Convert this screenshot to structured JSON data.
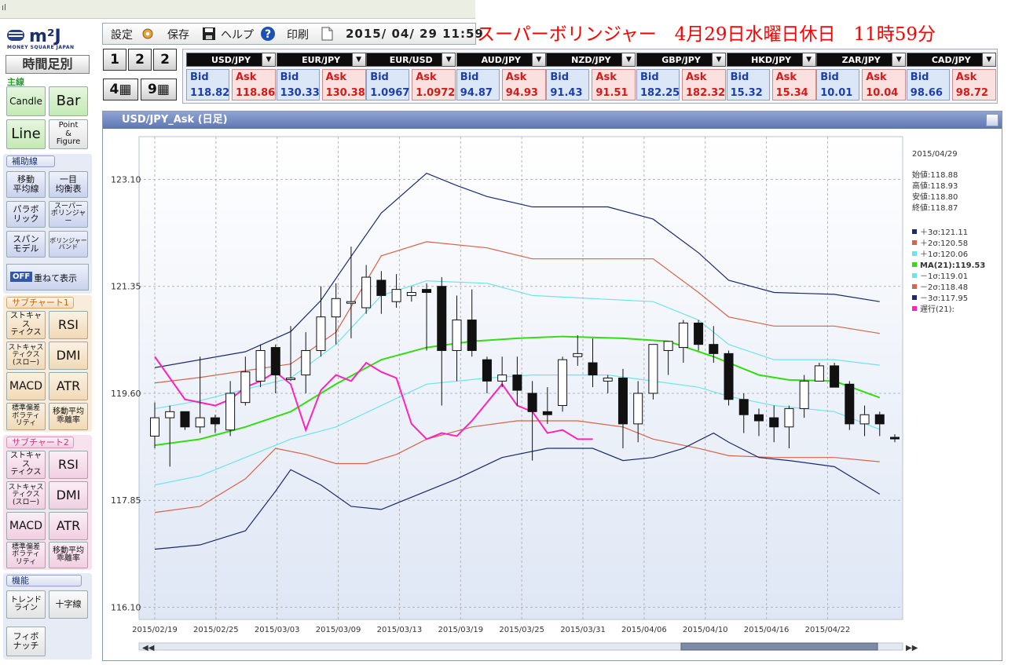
{
  "window": {
    "strip_text": "ıl"
  },
  "banner": {
    "text": "スーパーボリンジャー　4月29日水曜日休日　11時59分"
  },
  "sidebar": {
    "logo_mark": "m²J",
    "logo_sub": "MONEY SQUARE JAPAN",
    "timeframe_label": "時間足別",
    "main_label": "主線",
    "main_buttons": [
      {
        "label": "Candle"
      },
      {
        "label": "Bar"
      },
      {
        "label": "Line"
      },
      {
        "label": "Point\n&\nFigure"
      }
    ],
    "aux_title": "補助線",
    "aux_buttons": [
      {
        "label": "移動\n平均線"
      },
      {
        "label": "一目\n均衡表"
      },
      {
        "label": "パラボ\nリック"
      },
      {
        "label": "スーパー\nボリンジャー"
      },
      {
        "label": "スパン\nモデル"
      },
      {
        "label": "ボリンジャー\nバンド"
      }
    ],
    "overlay_toggle": {
      "state": "OFF",
      "label": "重ねて表示"
    },
    "sub1_title": "サブチャート1",
    "sub1_buttons": [
      {
        "label": "ストキャス\nティクス"
      },
      {
        "label": "RSI"
      },
      {
        "label": "ストキャス\nティクス\n(スロー)"
      },
      {
        "label": "DMI"
      },
      {
        "label": "MACD"
      },
      {
        "label": "ATR"
      },
      {
        "label": "標準偏差\nボラティ\nリティ"
      },
      {
        "label": "移動平均\n乖離率"
      }
    ],
    "sub2_title": "サブチャート2",
    "sub2_buttons": [
      {
        "label": "ストキャス\nティクス"
      },
      {
        "label": "RSI"
      },
      {
        "label": "ストキャス\nティクス\n(スロー)"
      },
      {
        "label": "DMI"
      },
      {
        "label": "MACD"
      },
      {
        "label": "ATR"
      },
      {
        "label": "標準偏差\nボラティ\nリティ"
      },
      {
        "label": "移動平均\n乖離率"
      }
    ],
    "func_title": "機能",
    "func_buttons": [
      {
        "label": "トレンド\nライン"
      },
      {
        "label": "十字線"
      },
      {
        "label": "フィボ\nナッチ"
      }
    ]
  },
  "toolbar": {
    "settings_label": "設定",
    "save_label": "保存",
    "help_label": "ヘルプ",
    "print_label": "印刷",
    "datetime": "2015/ 04/ 29  11:59"
  },
  "layout_buttons": [
    "1",
    "2",
    "2",
    "4",
    "9"
  ],
  "rates": [
    {
      "pair": "USD/JPY",
      "bid": "118.82",
      "ask": "118.86"
    },
    {
      "pair": "EUR/JPY",
      "bid": "130.33",
      "ask": "130.38"
    },
    {
      "pair": "EUR/USD",
      "bid": "1.0967",
      "ask": "1.0972"
    },
    {
      "pair": "AUD/JPY",
      "bid": "94.87",
      "ask": "94.93"
    },
    {
      "pair": "NZD/JPY",
      "bid": "91.43",
      "ask": "91.51"
    },
    {
      "pair": "GBP/JPY",
      "bid": "182.25",
      "ask": "182.32"
    },
    {
      "pair": "HKD/JPY",
      "bid": "15.32",
      "ask": "15.34"
    },
    {
      "pair": "ZAR/JPY",
      "bid": "10.01",
      "ask": "10.04"
    },
    {
      "pair": "CAD/JPY",
      "bid": "98.66",
      "ask": "98.72"
    }
  ],
  "rate_labels": {
    "bid": "Bid",
    "ask": "Ask"
  },
  "chart": {
    "title": "USD/JPY_Ask (日足)",
    "info_date": "2015/04/29",
    "ohlc": [
      {
        "label": "始値:",
        "value": "118.88"
      },
      {
        "label": "高値:",
        "value": "118.93"
      },
      {
        "label": "安値:",
        "value": "118.80"
      },
      {
        "label": "終値:",
        "value": "118.87"
      }
    ],
    "legend": [
      {
        "label": "＋3σ:",
        "value": "121.11",
        "color": "#1a2a6e"
      },
      {
        "label": "＋2σ:",
        "value": "120.58",
        "color": "#d8634a"
      },
      {
        "label": "＋1σ:",
        "value": "120.06",
        "color": "#6fe3ec"
      },
      {
        "label": "MA(21):",
        "value": "119.53",
        "color": "#33dd11",
        "bold": true
      },
      {
        "label": "－1σ:",
        "value": "119.01",
        "color": "#6fe3ec"
      },
      {
        "label": "－2σ:",
        "value": "118.48",
        "color": "#d8634a"
      },
      {
        "label": "－3σ:",
        "value": "117.95",
        "color": "#1a2a6e"
      },
      {
        "label": "遅行(21):",
        "value": "",
        "color": "#ff22bb"
      }
    ]
  },
  "chart_data": {
    "type": "candlestick",
    "title": "USD/JPY_Ask (日足)",
    "yticks": [
      "123.10",
      "121.35",
      "119.60",
      "117.85",
      "116.10"
    ],
    "ylim": [
      115.9,
      123.8
    ],
    "xticks": [
      "2015/02/19",
      "2015/02/25",
      "2015/03/03",
      "2015/03/09",
      "2015/03/13",
      "2015/03/19",
      "2015/03/25",
      "2015/03/31",
      "2015/04/06",
      "2015/04/10",
      "2015/04/16",
      "2015/04/22"
    ],
    "grid": true,
    "candles": [
      [
        118.9,
        119.45,
        118.7,
        119.2
      ],
      [
        119.2,
        119.4,
        118.4,
        119.3
      ],
      [
        119.3,
        119.2,
        119.0,
        119.05
      ],
      [
        119.05,
        120.2,
        118.95,
        119.2
      ],
      [
        119.2,
        119.25,
        118.95,
        119.1
      ],
      [
        119.0,
        119.8,
        118.9,
        119.6
      ],
      [
        119.45,
        120.2,
        119.4,
        119.95
      ],
      [
        119.8,
        120.4,
        119.7,
        120.3
      ],
      [
        120.35,
        120.4,
        119.6,
        119.9
      ],
      [
        119.85,
        120.7,
        119.8,
        119.85
      ],
      [
        119.9,
        120.6,
        119.6,
        120.3
      ],
      [
        120.3,
        121.35,
        120.2,
        120.85
      ],
      [
        120.85,
        121.4,
        120.4,
        121.15
      ],
      [
        121.1,
        122.0,
        120.5,
        121.1
      ],
      [
        121.0,
        121.7,
        120.9,
        121.5
      ],
      [
        121.45,
        121.6,
        120.9,
        121.2
      ],
      [
        121.1,
        121.55,
        121.0,
        121.3
      ],
      [
        121.2,
        121.35,
        121.1,
        121.25
      ],
      [
        121.3,
        121.4,
        120.3,
        121.25
      ],
      [
        121.35,
        121.5,
        119.4,
        120.3
      ],
      [
        120.3,
        121.2,
        119.8,
        120.8
      ],
      [
        120.8,
        121.3,
        120.2,
        120.3
      ],
      [
        120.15,
        120.2,
        119.6,
        119.8
      ],
      [
        119.8,
        120.2,
        119.7,
        119.9
      ],
      [
        119.9,
        120.2,
        119.4,
        119.65
      ],
      [
        119.6,
        119.8,
        118.5,
        119.3
      ],
      [
        119.3,
        119.7,
        119.1,
        119.25
      ],
      [
        119.4,
        120.2,
        119.3,
        120.15
      ],
      [
        120.2,
        120.55,
        120.05,
        120.25
      ],
      [
        120.1,
        120.5,
        119.7,
        119.9
      ],
      [
        119.8,
        119.9,
        119.6,
        119.85
      ],
      [
        119.85,
        120.0,
        118.7,
        119.1
      ],
      [
        119.1,
        119.8,
        118.8,
        119.6
      ],
      [
        119.6,
        120.4,
        119.5,
        120.4
      ],
      [
        120.3,
        120.4,
        119.9,
        120.45
      ],
      [
        120.35,
        120.8,
        120.1,
        120.75
      ],
      [
        120.75,
        120.8,
        120.3,
        120.4
      ],
      [
        120.4,
        120.7,
        120.1,
        120.25
      ],
      [
        120.25,
        120.3,
        119.4,
        119.5
      ],
      [
        119.5,
        119.6,
        118.95,
        119.25
      ],
      [
        119.25,
        119.35,
        118.9,
        119.15
      ],
      [
        119.2,
        119.4,
        118.8,
        119.05
      ],
      [
        119.05,
        119.4,
        118.7,
        119.35
      ],
      [
        119.35,
        119.9,
        119.2,
        119.8
      ],
      [
        119.8,
        120.1,
        119.8,
        120.05
      ],
      [
        120.05,
        120.1,
        119.7,
        119.7
      ],
      [
        119.75,
        119.8,
        119.0,
        119.1
      ],
      [
        119.1,
        119.4,
        118.9,
        119.25
      ],
      [
        119.25,
        119.3,
        118.9,
        119.1
      ],
      [
        118.88,
        118.93,
        118.8,
        118.87
      ]
    ],
    "series": [
      {
        "name": "+3σ",
        "values": [
          null,
          null,
          null,
          null,
          null,
          null,
          null,
          null,
          null,
          null,
          null,
          null,
          null,
          null,
          null,
          null,
          null,
          null,
          null,
          null,
          null,
          null,
          null,
          null,
          null,
          null,
          null,
          null,
          null,
          null,
          null,
          null,
          null,
          null,
          null,
          null,
          null,
          null,
          null,
          null,
          null,
          null,
          null,
          null,
          null,
          null,
          null,
          null,
          null,
          null
        ],
        "line": [
          [
            0,
            120.02
          ],
          [
            6,
            120.28
          ],
          [
            9,
            120.61
          ],
          [
            11,
            121.12
          ],
          [
            13,
            121.84
          ],
          [
            15,
            122.55
          ],
          [
            18,
            123.2
          ],
          [
            20,
            123.0
          ],
          [
            22,
            122.82
          ],
          [
            25,
            122.65
          ],
          [
            30,
            122.65
          ],
          [
            33,
            122.45
          ],
          [
            36,
            121.9
          ],
          [
            38,
            121.45
          ],
          [
            41,
            121.25
          ],
          [
            45,
            121.22
          ],
          [
            48,
            121.1
          ]
        ]
      },
      {
        "name": "+2σ",
        "values": [],
        "line": [
          [
            0,
            119.77
          ],
          [
            3,
            119.86
          ],
          [
            9,
            120.08
          ],
          [
            12,
            120.6
          ],
          [
            15,
            121.85
          ],
          [
            18,
            122.08
          ],
          [
            22,
            121.98
          ],
          [
            25,
            121.8
          ],
          [
            33,
            121.8
          ],
          [
            36,
            121.25
          ],
          [
            38,
            120.85
          ],
          [
            41,
            120.7
          ],
          [
            45,
            120.7
          ],
          [
            48,
            120.58
          ]
        ]
      },
      {
        "name": "+1σ",
        "values": [],
        "line": [
          [
            0,
            119.35
          ],
          [
            3,
            119.48
          ],
          [
            9,
            119.85
          ],
          [
            12,
            120.4
          ],
          [
            15,
            121.2
          ],
          [
            18,
            121.44
          ],
          [
            22,
            121.4
          ],
          [
            25,
            121.2
          ],
          [
            33,
            121.1
          ],
          [
            36,
            120.8
          ],
          [
            38,
            120.4
          ],
          [
            41,
            120.15
          ],
          [
            45,
            120.15
          ],
          [
            48,
            120.06
          ]
        ]
      },
      {
        "name": "MA(21)",
        "values": [],
        "line": [
          [
            0,
            118.75
          ],
          [
            3,
            118.85
          ],
          [
            6,
            119.05
          ],
          [
            9,
            119.3
          ],
          [
            12,
            119.75
          ],
          [
            15,
            120.15
          ],
          [
            18,
            120.35
          ],
          [
            21,
            120.45
          ],
          [
            24,
            120.5
          ],
          [
            27,
            120.53
          ],
          [
            31,
            120.5
          ],
          [
            34,
            120.45
          ],
          [
            37,
            120.2
          ],
          [
            40,
            119.9
          ],
          [
            42,
            119.82
          ],
          [
            45,
            119.8
          ],
          [
            48,
            119.53
          ]
        ]
      },
      {
        "name": "-1σ",
        "values": [],
        "line": [
          [
            0,
            118.1
          ],
          [
            3,
            118.25
          ],
          [
            6,
            118.55
          ],
          [
            9,
            118.85
          ],
          [
            12,
            119.05
          ],
          [
            15,
            119.4
          ],
          [
            18,
            119.75
          ],
          [
            22,
            119.85
          ],
          [
            25,
            119.9
          ],
          [
            30,
            119.9
          ],
          [
            33,
            119.8
          ],
          [
            36,
            119.7
          ],
          [
            38,
            119.55
          ],
          [
            41,
            119.4
          ],
          [
            45,
            119.3
          ],
          [
            48,
            119.01
          ]
        ]
      },
      {
        "name": "-2σ",
        "values": [],
        "line": [
          [
            0,
            117.65
          ],
          [
            3,
            117.75
          ],
          [
            6,
            118.2
          ],
          [
            8,
            118.7
          ],
          [
            10,
            118.6
          ],
          [
            12,
            118.45
          ],
          [
            14,
            118.45
          ],
          [
            16,
            118.6
          ],
          [
            18,
            118.85
          ],
          [
            21,
            119.05
          ],
          [
            24,
            119.15
          ],
          [
            28,
            119.15
          ],
          [
            31,
            119.05
          ],
          [
            33,
            118.85
          ],
          [
            36,
            118.7
          ],
          [
            38,
            118.58
          ],
          [
            41,
            118.55
          ],
          [
            45,
            118.55
          ],
          [
            48,
            118.48
          ]
        ]
      },
      {
        "name": "-3σ",
        "values": [],
        "line": [
          [
            0,
            117.05
          ],
          [
            3,
            117.12
          ],
          [
            6,
            117.35
          ],
          [
            8,
            118.0
          ],
          [
            9,
            118.35
          ],
          [
            11,
            118.1
          ],
          [
            13,
            117.75
          ],
          [
            15,
            117.7
          ],
          [
            17,
            117.9
          ],
          [
            20,
            118.2
          ],
          [
            23,
            118.55
          ],
          [
            26,
            118.7
          ],
          [
            29,
            118.7
          ],
          [
            31,
            118.5
          ],
          [
            33,
            118.55
          ],
          [
            35,
            118.7
          ],
          [
            37,
            118.95
          ],
          [
            38,
            118.8
          ],
          [
            40,
            118.55
          ],
          [
            42,
            118.5
          ],
          [
            45,
            118.4
          ],
          [
            48,
            117.95
          ]
        ]
      },
      {
        "name": "遅行(21)",
        "values": [],
        "line": [
          [
            0,
            120.2
          ],
          [
            1,
            119.85
          ],
          [
            2,
            119.5
          ],
          [
            3,
            119.45
          ],
          [
            4,
            119.4
          ],
          [
            5,
            119.5
          ],
          [
            6,
            119.7
          ],
          [
            7,
            119.8
          ],
          [
            8,
            119.95
          ],
          [
            9,
            119.75
          ],
          [
            10,
            119.0
          ],
          [
            11,
            119.65
          ],
          [
            12,
            119.9
          ],
          [
            13,
            119.8
          ],
          [
            14,
            120.1
          ],
          [
            15,
            119.95
          ],
          [
            16,
            119.85
          ],
          [
            17,
            119.1
          ],
          [
            18,
            118.85
          ],
          [
            19,
            118.95
          ],
          [
            20,
            118.9
          ],
          [
            21,
            119.15
          ],
          [
            22,
            119.45
          ],
          [
            23,
            119.75
          ],
          [
            24,
            119.4
          ],
          [
            25,
            119.3
          ],
          [
            26,
            118.95
          ],
          [
            27,
            119.0
          ],
          [
            28,
            118.85
          ],
          [
            29,
            118.85
          ]
        ]
      }
    ]
  }
}
